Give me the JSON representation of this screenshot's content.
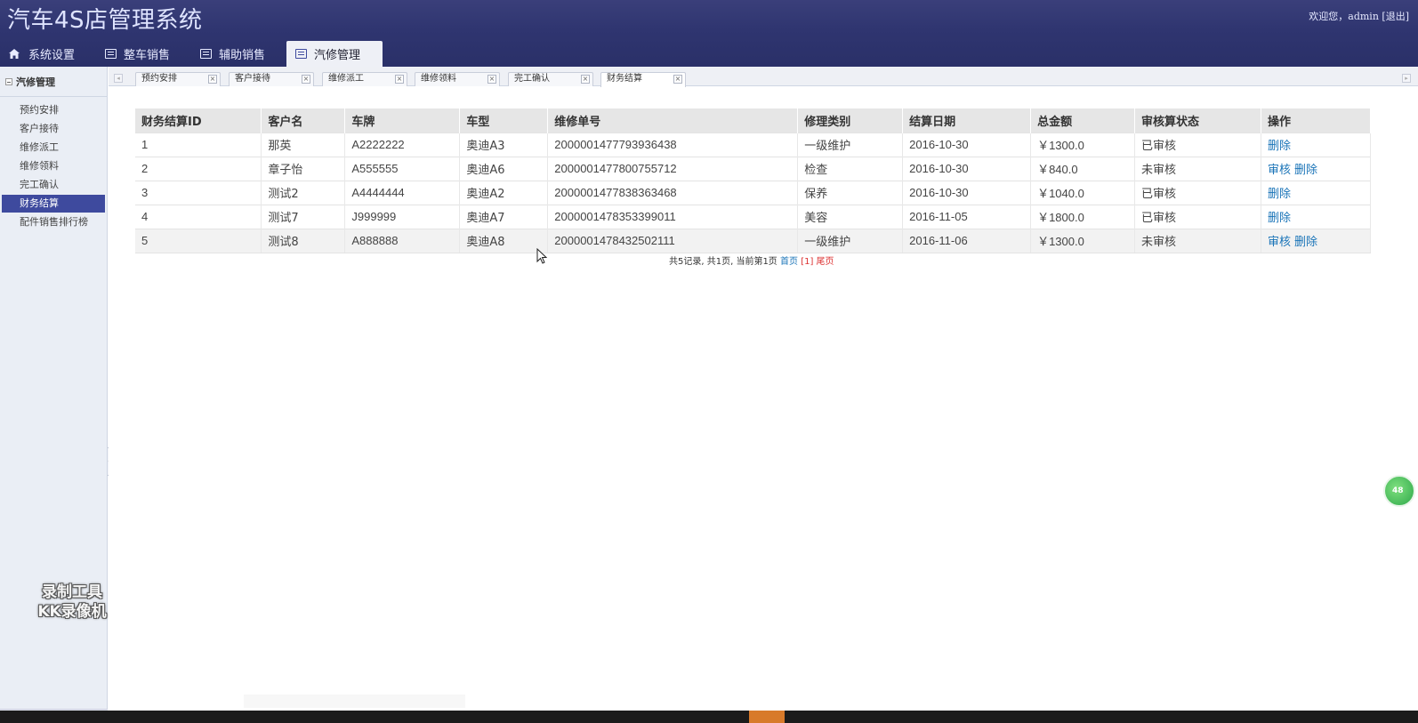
{
  "header": {
    "title": "汽车4S店管理系统",
    "userinfo": "欢迎您，admin [退出]"
  },
  "nav": {
    "tabs": [
      {
        "label": "系统设置",
        "icon": "home-icon"
      },
      {
        "label": "整车销售",
        "icon": "list-icon"
      },
      {
        "label": "辅助销售",
        "icon": "list-icon"
      },
      {
        "label": "汽修管理",
        "icon": "list-icon",
        "active": true
      }
    ]
  },
  "sidebar": {
    "heading": "汽修管理",
    "items": [
      "预约安排",
      "客户接待",
      "维修派工",
      "维修领料",
      "完工确认",
      "财务结算",
      "配件销售排行榜"
    ],
    "active": "财务结算"
  },
  "content_tabs": [
    "预约安排",
    "客户接待",
    "维修派工",
    "维修领料",
    "完工确认",
    "财务结算"
  ],
  "table": {
    "headers": [
      "财务结算ID",
      "客户名",
      "车牌",
      "车型",
      "维修单号",
      "修理类别",
      "结算日期",
      "总金额",
      "审核算状态",
      "操作"
    ],
    "rows": [
      {
        "id": "1",
        "customer": "那英",
        "plate": "A2222222",
        "model": "奥迪A3",
        "order": "2000001477793936438",
        "category": "一级维护",
        "date": "2016-10-30",
        "amount": "￥1300.0",
        "status": "已审核",
        "actions": [
          "删除"
        ]
      },
      {
        "id": "2",
        "customer": "章子怡",
        "plate": "A555555",
        "model": "奥迪A6",
        "order": "2000001477800755712",
        "category": "检查",
        "date": "2016-10-30",
        "amount": "￥840.0",
        "status": "未审核",
        "actions": [
          "审核",
          "删除"
        ]
      },
      {
        "id": "3",
        "customer": "测试2",
        "plate": "A4444444",
        "model": "奥迪A2",
        "order": "2000001477838363468",
        "category": "保养",
        "date": "2016-10-30",
        "amount": "￥1040.0",
        "status": "已审核",
        "actions": [
          "删除"
        ]
      },
      {
        "id": "4",
        "customer": "测试7",
        "plate": "J999999",
        "model": "奥迪A7",
        "order": "2000001478353399011",
        "category": "美容",
        "date": "2016-11-05",
        "amount": "￥1800.0",
        "status": "已审核",
        "actions": [
          "删除"
        ]
      },
      {
        "id": "5",
        "customer": "测试8",
        "plate": "A888888",
        "model": "奥迪A8",
        "order": "2000001478432502111",
        "category": "一级维护",
        "date": "2016-11-06",
        "amount": "￥1300.0",
        "status": "未审核",
        "actions": [
          "审核",
          "删除"
        ]
      }
    ]
  },
  "pager": {
    "summary": "共5记录, 共1页, 当前第1页",
    "first": "首页",
    "current": "[1]",
    "last": "尾页"
  },
  "watermark": {
    "line1": "录制工具",
    "line2": "KK录像机"
  },
  "float_ball": "48"
}
